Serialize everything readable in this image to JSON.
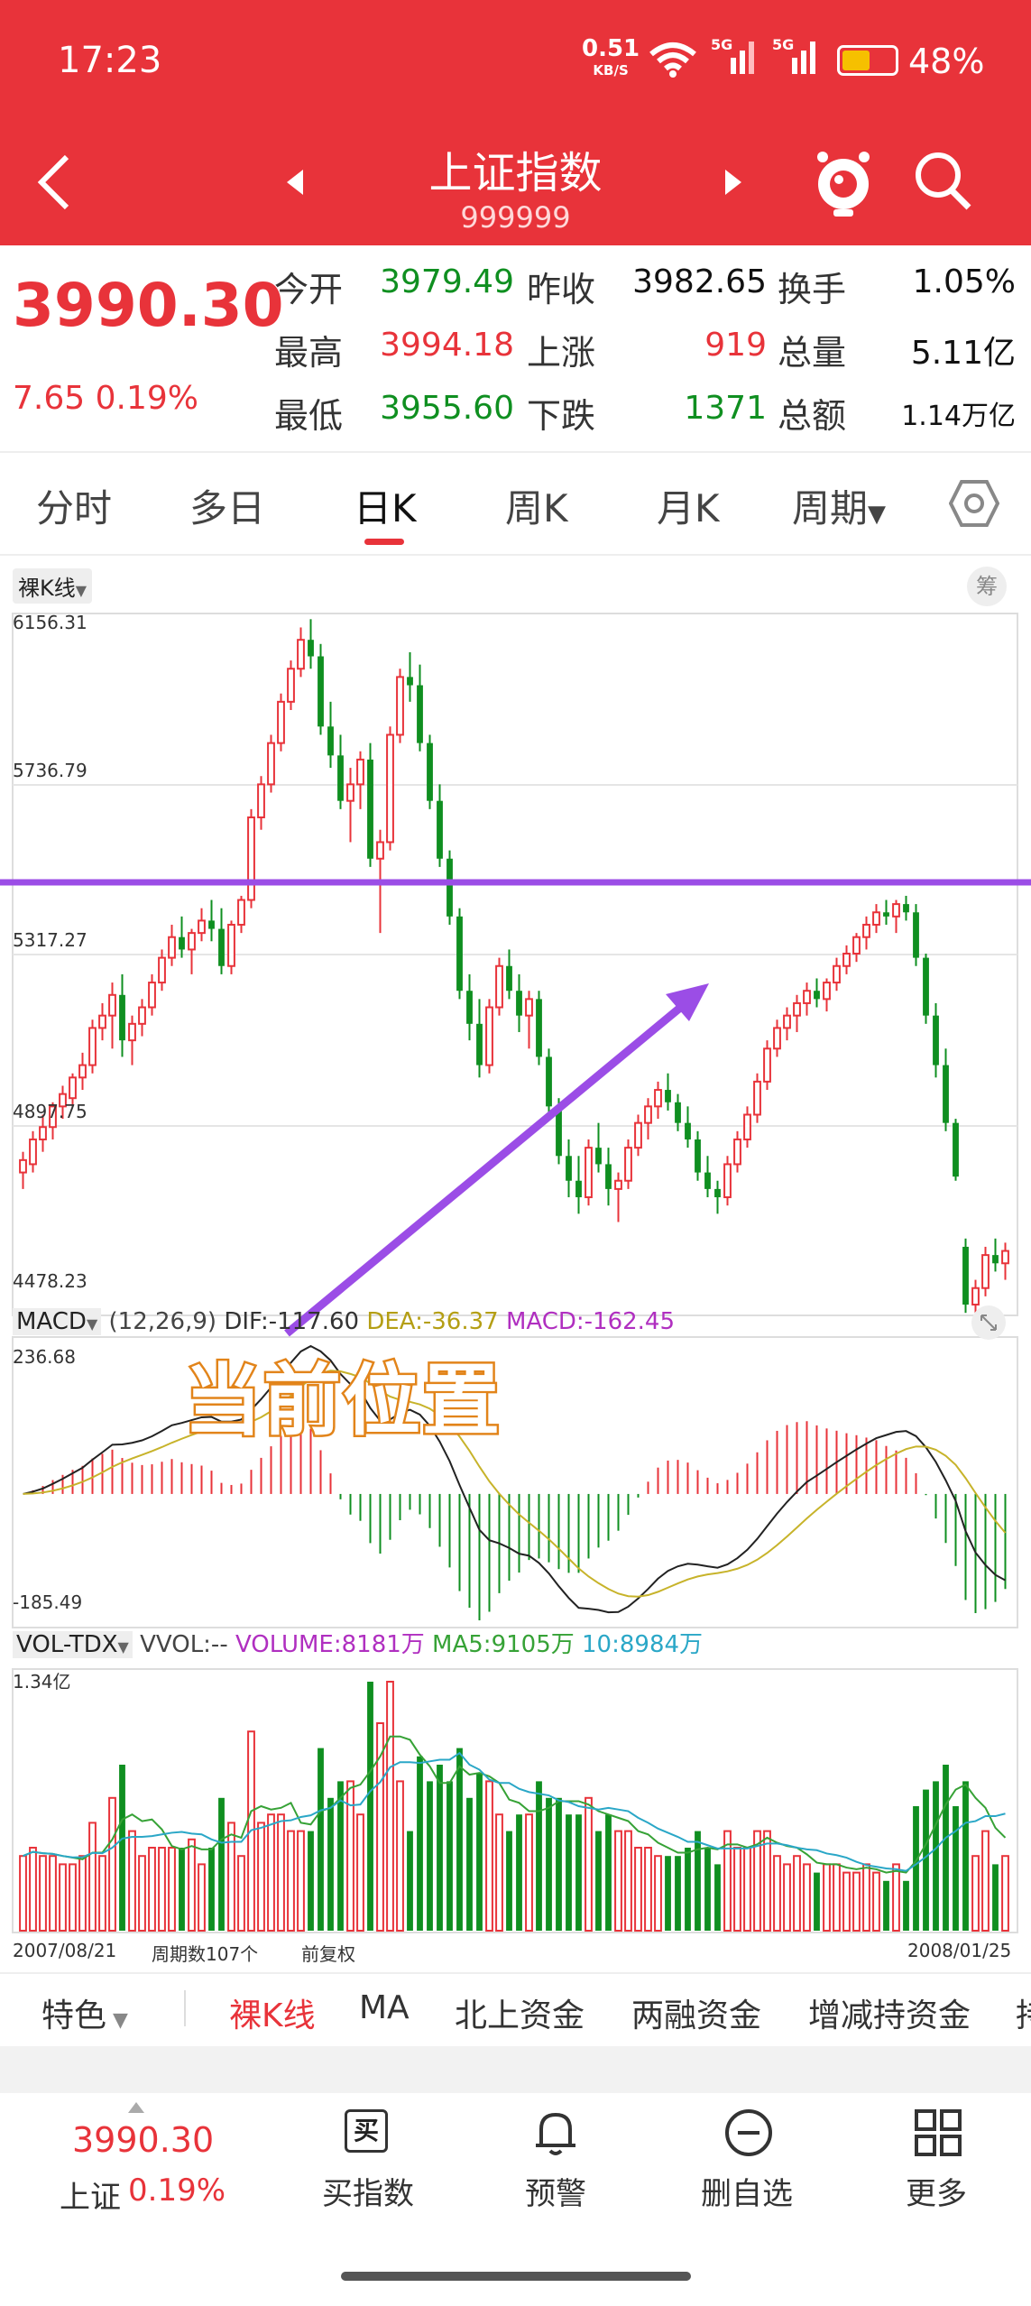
{
  "status_bar": {
    "time": "17:23",
    "net_speed": "0.51",
    "net_unit": "KB/S",
    "signal1": "5G",
    "signal2": "5G",
    "battery": "48%"
  },
  "nav": {
    "title": "上证指数",
    "code": "999999",
    "icons": [
      "back-icon",
      "prev-icon",
      "next-icon",
      "mascot-icon",
      "search-icon"
    ]
  },
  "quote": {
    "price": "3990.30",
    "change": "7.65 0.19%",
    "rows": [
      [
        {
          "label": "今开",
          "value": "3979.49",
          "color": "green"
        },
        {
          "label": "昨收",
          "value": "3982.65",
          "color": "black"
        },
        {
          "label": "换手",
          "value": "1.05%",
          "color": "black"
        }
      ],
      [
        {
          "label": "最高",
          "value": "3994.18",
          "color": "red"
        },
        {
          "label": "上涨",
          "value": "919",
          "color": "red"
        },
        {
          "label": "总量",
          "value": "5.11亿",
          "color": "black"
        }
      ],
      [
        {
          "label": "最低",
          "value": "3955.60",
          "color": "green"
        },
        {
          "label": "下跌",
          "value": "1371",
          "color": "green"
        },
        {
          "label": "总额",
          "value": "1.14万亿",
          "color": "black"
        }
      ]
    ]
  },
  "period_tabs": [
    "分时",
    "多日",
    "日K",
    "周K",
    "月K",
    "周期"
  ],
  "active_tab": "日K",
  "kline": {
    "selector": "裸K线",
    "chip_label": "筹",
    "y_labels": [
      "6156.31",
      "5736.79",
      "5317.27",
      "4897.75",
      "4478.23"
    ]
  },
  "macd": {
    "name": "MACD",
    "params": "(12,26,9)",
    "dif": "DIF:-117.60",
    "dea": "DEA:-36.37",
    "macd": "MACD:-162.45",
    "y_top": "236.68",
    "y_bottom": "-185.49"
  },
  "volume": {
    "name": "VOL-TDX",
    "vvol": "VVOL:--",
    "vol": "VOLUME:8181万",
    "ma5": "MA5:9105万",
    "ma10": "10:8984万",
    "y_top": "1.34亿",
    "date_start": "2007/08/21",
    "period_count": "周期数107个",
    "adjust": "前复权",
    "date_end": "2008/01/25"
  },
  "annotation": {
    "text": "当前位置"
  },
  "bottom_tabs": [
    "特色",
    "裸K线",
    "MA",
    "北上资金",
    "两融资金",
    "增减持资金",
    "持"
  ],
  "footer": {
    "price": "3990.30",
    "name": "上证",
    "pct": "0.19%",
    "buttons": [
      {
        "icon": "buy-icon",
        "glyph": "买",
        "label": "买指数"
      },
      {
        "icon": "bell-icon",
        "label": "预警"
      },
      {
        "icon": "minus-circle-icon",
        "label": "删自选"
      },
      {
        "icon": "grid-icon",
        "label": "更多"
      }
    ]
  },
  "colors": {
    "brand_red": "#e8333a",
    "up": "#e8333a",
    "down": "#0f8f20",
    "annotation_line": "#9b4de6",
    "dif_line": "#222222",
    "dea_line": "#c7b32a",
    "ma5": "#36a236",
    "ma10": "#2aa7c7"
  },
  "chart_data": {
    "type": "candlestick",
    "period_count": 107,
    "date_start": "2007/08/21",
    "date_end": "2008/01/25",
    "ohlc": [
      [
        4820,
        4870,
        4780,
        4850
      ],
      [
        4840,
        4920,
        4820,
        4900
      ],
      [
        4900,
        4960,
        4870,
        4930
      ],
      [
        4930,
        4990,
        4900,
        4980
      ],
      [
        4980,
        5030,
        4950,
        5010
      ],
      [
        5000,
        5060,
        4980,
        5050
      ],
      [
        5050,
        5110,
        5020,
        5080
      ],
      [
        5080,
        5190,
        5060,
        5170
      ],
      [
        5170,
        5230,
        5140,
        5200
      ],
      [
        5200,
        5280,
        5120,
        5250
      ],
      [
        5250,
        5300,
        5100,
        5140
      ],
      [
        5140,
        5200,
        5080,
        5180
      ],
      [
        5180,
        5240,
        5150,
        5220
      ],
      [
        5220,
        5300,
        5200,
        5280
      ],
      [
        5280,
        5360,
        5260,
        5340
      ],
      [
        5340,
        5420,
        5320,
        5390
      ],
      [
        5390,
        5440,
        5340,
        5360
      ],
      [
        5360,
        5410,
        5300,
        5400
      ],
      [
        5400,
        5460,
        5380,
        5430
      ],
      [
        5430,
        5480,
        5380,
        5410
      ],
      [
        5410,
        5460,
        5300,
        5320
      ],
      [
        5320,
        5430,
        5300,
        5420
      ],
      [
        5420,
        5490,
        5400,
        5480
      ],
      [
        5480,
        5700,
        5460,
        5680
      ],
      [
        5680,
        5780,
        5650,
        5760
      ],
      [
        5760,
        5880,
        5740,
        5860
      ],
      [
        5860,
        5980,
        5840,
        5960
      ],
      [
        5960,
        6060,
        5940,
        6040
      ],
      [
        6040,
        6140,
        6020,
        6110
      ],
      [
        6110,
        6160,
        6040,
        6070
      ],
      [
        6070,
        6100,
        5880,
        5900
      ],
      [
        5900,
        5960,
        5800,
        5830
      ],
      [
        5830,
        5880,
        5700,
        5720
      ],
      [
        5720,
        5800,
        5620,
        5760
      ],
      [
        5760,
        5840,
        5700,
        5820
      ],
      [
        5820,
        5860,
        5560,
        5580
      ],
      [
        5580,
        5650,
        5400,
        5620
      ],
      [
        5620,
        5900,
        5600,
        5880
      ],
      [
        5880,
        6040,
        5860,
        6020
      ],
      [
        6020,
        6080,
        5960,
        6000
      ],
      [
        6000,
        6050,
        5840,
        5860
      ],
      [
        5860,
        5880,
        5700,
        5720
      ],
      [
        5720,
        5760,
        5560,
        5580
      ],
      [
        5580,
        5600,
        5420,
        5440
      ],
      [
        5440,
        5460,
        5240,
        5260
      ],
      [
        5260,
        5300,
        5140,
        5180
      ],
      [
        5180,
        5240,
        5050,
        5080
      ],
      [
        5080,
        5240,
        5060,
        5220
      ],
      [
        5220,
        5340,
        5200,
        5320
      ],
      [
        5320,
        5360,
        5240,
        5260
      ],
      [
        5260,
        5300,
        5160,
        5200
      ],
      [
        5200,
        5260,
        5120,
        5240
      ],
      [
        5240,
        5260,
        5080,
        5100
      ],
      [
        5100,
        5120,
        4960,
        4980
      ],
      [
        4980,
        5000,
        4840,
        4860
      ],
      [
        4860,
        4900,
        4760,
        4800
      ],
      [
        4800,
        4860,
        4720,
        4760
      ],
      [
        4760,
        4900,
        4740,
        4880
      ],
      [
        4880,
        4940,
        4820,
        4840
      ],
      [
        4840,
        4880,
        4740,
        4780
      ],
      [
        4780,
        4820,
        4700,
        4800
      ],
      [
        4800,
        4900,
        4780,
        4880
      ],
      [
        4880,
        4960,
        4860,
        4940
      ],
      [
        4940,
        5000,
        4900,
        4980
      ],
      [
        4980,
        5040,
        4950,
        5020
      ],
      [
        5020,
        5060,
        4970,
        4990
      ],
      [
        4990,
        5010,
        4920,
        4940
      ],
      [
        4940,
        4980,
        4880,
        4900
      ],
      [
        4900,
        4920,
        4800,
        4820
      ],
      [
        4820,
        4860,
        4760,
        4780
      ],
      [
        4780,
        4800,
        4720,
        4760
      ],
      [
        4760,
        4860,
        4740,
        4840
      ],
      [
        4840,
        4920,
        4820,
        4900
      ],
      [
        4900,
        4980,
        4880,
        4960
      ],
      [
        4960,
        5060,
        4940,
        5040
      ],
      [
        5040,
        5140,
        5020,
        5120
      ],
      [
        5120,
        5190,
        5100,
        5170
      ],
      [
        5170,
        5220,
        5140,
        5200
      ],
      [
        5200,
        5250,
        5160,
        5230
      ],
      [
        5230,
        5280,
        5200,
        5260
      ],
      [
        5260,
        5290,
        5220,
        5240
      ],
      [
        5240,
        5290,
        5210,
        5280
      ],
      [
        5280,
        5340,
        5260,
        5320
      ],
      [
        5320,
        5370,
        5300,
        5350
      ],
      [
        5350,
        5400,
        5330,
        5390
      ],
      [
        5390,
        5440,
        5360,
        5420
      ],
      [
        5420,
        5470,
        5400,
        5450
      ],
      [
        5450,
        5480,
        5420,
        5440
      ],
      [
        5440,
        5480,
        5400,
        5470
      ],
      [
        5470,
        5490,
        5430,
        5450
      ],
      [
        5450,
        5470,
        5320,
        5340
      ],
      [
        5340,
        5350,
        5180,
        5200
      ],
      [
        5200,
        5230,
        5050,
        5080
      ],
      [
        5080,
        5120,
        4920,
        4940
      ],
      [
        4940,
        4950,
        4800,
        4810
      ],
      [
        4640,
        4660,
        4480,
        4500
      ],
      [
        4500,
        4560,
        4470,
        4540
      ],
      [
        4540,
        4640,
        4520,
        4620
      ],
      [
        4620,
        4660,
        4580,
        4600
      ],
      [
        4600,
        4650,
        4560,
        4630
      ]
    ],
    "y_range": [
      4478.23,
      6156.31
    ]
  }
}
